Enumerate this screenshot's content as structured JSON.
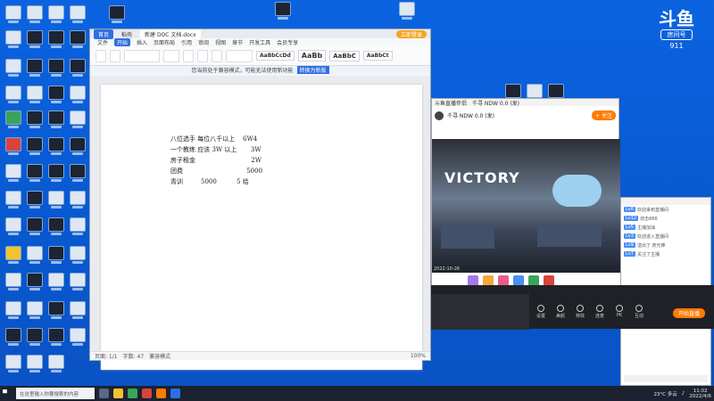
{
  "desktop": {
    "douyu": {
      "logo": "斗鱼",
      "tag": "房间号",
      "room": "911"
    },
    "top_icons": [
      "",
      "",
      ""
    ]
  },
  "word": {
    "tabs": [
      {
        "label": "首页"
      },
      {
        "label": "稻壳"
      },
      {
        "label": "新建 DOC 文档.docx"
      }
    ],
    "login_label": "立即登录",
    "menu": [
      "文件",
      "开始",
      "插入",
      "页面布局",
      "引用",
      "审阅",
      "视图",
      "章节",
      "开发工具",
      "会员专享"
    ],
    "ribbon_styles": [
      "AaBbCcDd",
      "AaBb",
      "AaBbC",
      "AaBbCt"
    ],
    "notice": {
      "text": "您当前处于兼容模式，可能无法使用新功能",
      "action": "转换为新版"
    },
    "document_lines": [
      "八位选手 每位八千以上    6W4",
      "一个教练 应该 3W 以上       3W",
      "房子租金                            2W",
      "团费                                5000",
      "青训         5000          5 给"
    ],
    "status": {
      "page": "页面: 1/1",
      "words": "字数: 47",
      "mode": "兼容模式",
      "zoom": "100%"
    }
  },
  "live": {
    "header": {
      "title": "斗鱼直播伴侣",
      "tab": "千寻 NDW 0.0 (发)",
      "follow": "+ 关注"
    },
    "video": {
      "brand": "VICTORY",
      "timestamp": "2022-10-26"
    },
    "controls": [
      "设置",
      "美颜",
      "特效",
      "连麦",
      "PK",
      "互动"
    ],
    "go_live_label": "开始直播"
  },
  "chat": {
    "lines": [
      {
        "badge": "Lv8",
        "text": "欢迎来到直播间"
      },
      {
        "badge": "Lv12",
        "text": "双击666"
      },
      {
        "badge": "Lv5",
        "text": "主播加油"
      },
      {
        "badge": "Lv3",
        "text": "欢迎进入直播间"
      },
      {
        "badge": "Lv9",
        "text": "送出了 荧光棒"
      },
      {
        "badge": "Lv7",
        "text": "关注了主播"
      }
    ]
  },
  "taskbar": {
    "search_placeholder": "在这里输入你要搜索的内容",
    "weather": "23°C 多云",
    "time": "11:02",
    "date": "2022/4/6"
  },
  "colors": {
    "accent": "#2f6fe3",
    "douyu_orange": "#ff7a00",
    "desktop": "#0a5bd3"
  }
}
